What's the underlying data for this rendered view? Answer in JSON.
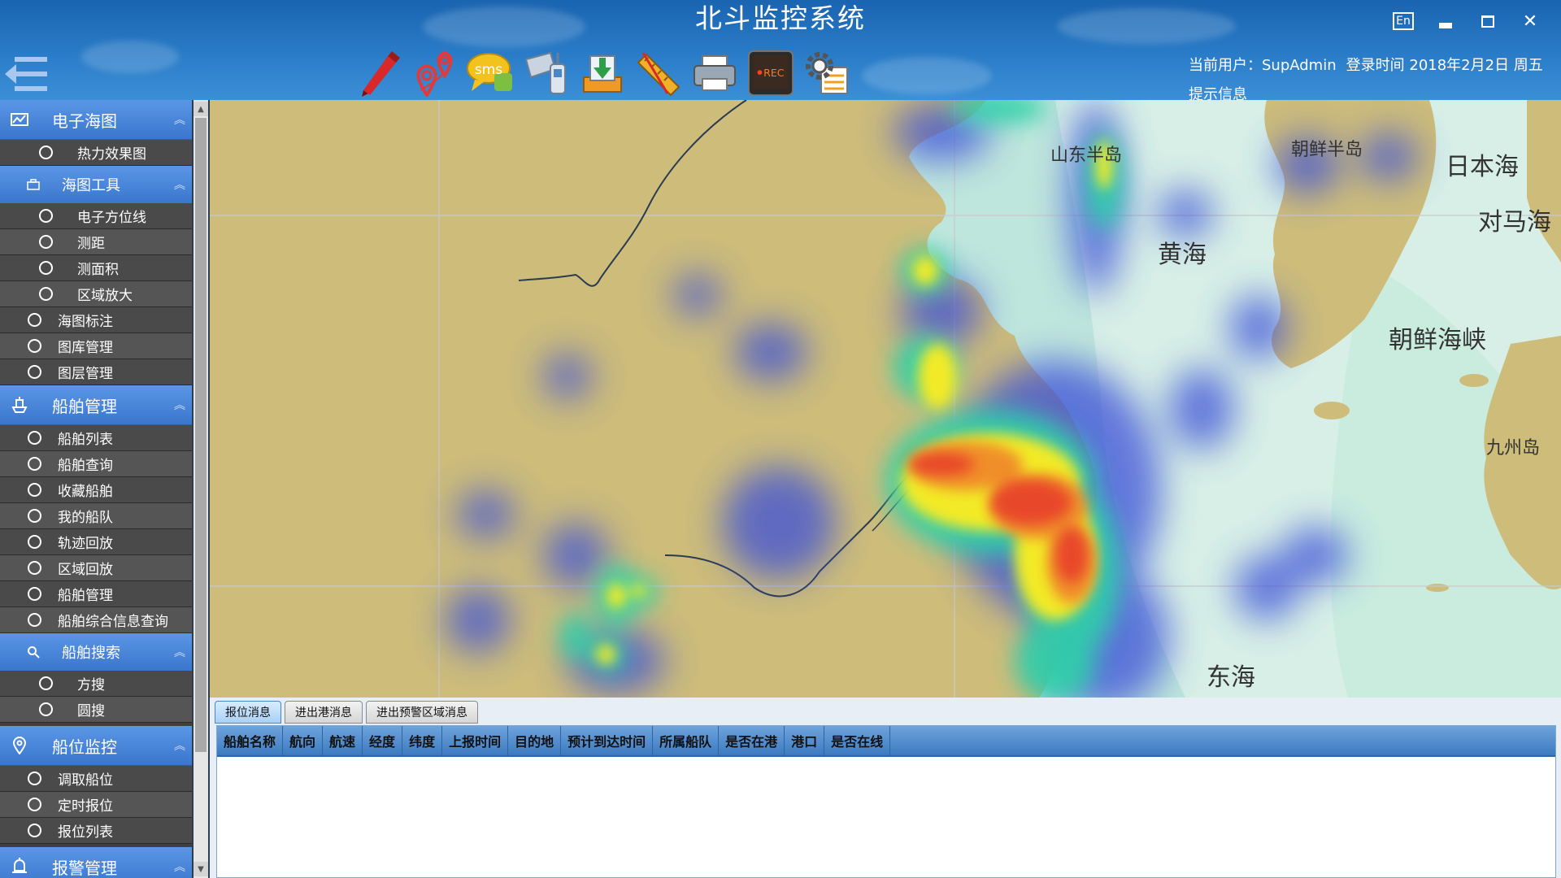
{
  "window": {
    "title": "北斗监控系统",
    "lang_label": "En",
    "minimize_icon": "minimize-icon",
    "maximize_icon": "maximize-icon",
    "close_icon": "close-icon"
  },
  "toolbar": {
    "tools": [
      {
        "name": "draw-tool",
        "icon": "pencil-icon"
      },
      {
        "name": "locate-tool",
        "icon": "map-pin-icon"
      },
      {
        "name": "sms-tool",
        "icon": "sms-icon",
        "label": "sms"
      },
      {
        "name": "satellite-phone-tool",
        "icon": "satellite-phone-icon"
      },
      {
        "name": "download-tool",
        "icon": "download-tray-icon"
      },
      {
        "name": "ruler-tool",
        "icon": "ruler-icon"
      },
      {
        "name": "print-tool",
        "icon": "printer-icon"
      },
      {
        "name": "record-tool",
        "icon": "rec-screen-icon",
        "label": "REC"
      },
      {
        "name": "settings-tool",
        "icon": "gear-document-icon"
      }
    ]
  },
  "user": {
    "current_user": "当前用户：SupAdmin",
    "login_time": "登录时间 2018年2月2日 周五",
    "hint": "提示信息"
  },
  "sidebar": {
    "sections": [
      {
        "label": "电子海图",
        "icon": "chart-icon"
      },
      {
        "label": "船舶管理",
        "icon": "ship-icon"
      },
      {
        "label": "船位监控",
        "icon": "location-pin-icon"
      },
      {
        "label": "报警管理",
        "icon": "alarm-bell-icon"
      }
    ],
    "chart_items": {
      "heatmap": "热力效果图",
      "tools_header": "海图工具",
      "tools": [
        "电子方位线",
        "测距",
        "测面积",
        "区域放大"
      ],
      "others": [
        "海图标注",
        "图库管理",
        "图层管理"
      ]
    },
    "ship_items": [
      "船舶列表",
      "船舶查询",
      "收藏船舶",
      "我的船队",
      "轨迹回放",
      "区域回放",
      "船舶管理",
      "船舶综合信息查询"
    ],
    "search": {
      "header": "船舶搜索",
      "items": [
        "方搜",
        "圆搜"
      ]
    },
    "monitor_items": [
      "调取船位",
      "定时报位",
      "报位列表"
    ]
  },
  "map": {
    "labels": [
      "山东半岛",
      "朝鲜半岛",
      "日本海",
      "对马海",
      "黄海",
      "朝鲜海峡",
      "九州岛",
      "东海"
    ],
    "colors": {
      "land": "#cdbc7a",
      "sea_shallow": "#bfe6dc",
      "sea_deep": "#d7efe6",
      "heat_high": "#e8402a",
      "heat_mid": "#f2ea28",
      "heat_low": "#3a4fd8"
    }
  },
  "messages": {
    "tabs": [
      "报位消息",
      "进出港消息",
      "进出预警区域消息"
    ],
    "columns": [
      "船舶名称",
      "航向",
      "航速",
      "经度",
      "纬度",
      "上报时间",
      "目的地",
      "预计到达时间",
      "所属船队",
      "是否在港",
      "港口",
      "是否在线"
    ],
    "rows": []
  }
}
